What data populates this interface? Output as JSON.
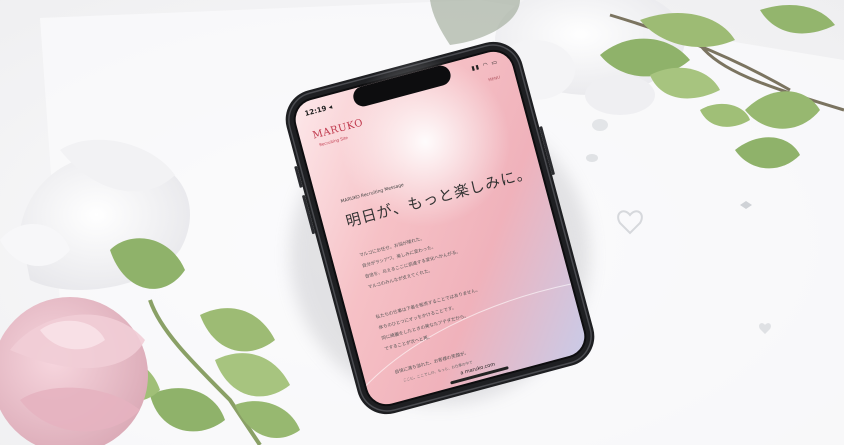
{
  "scene": {
    "description_tags": [
      "smartphone-mockup",
      "flowers",
      "leaves",
      "white-table"
    ],
    "colors": {
      "background": "#f6f6f7",
      "phone_frame": "#1e1f22",
      "screen_gradient_pink": "#f3b7bf",
      "screen_gradient_lavender": "#c8c9e6",
      "brand_red": "#c0394d",
      "leaf_green": "#8fb26a",
      "peony_pink": "#eec0cb"
    }
  },
  "phone": {
    "status_time": "12:19 ◂",
    "status_icons": "▮▮ ◠ ▭",
    "menu_link": "MENU",
    "brand": "MARUKO",
    "brand_subtitle": "Recruiting Site",
    "kicker": "MARUKO Recruiting Message",
    "headline": "明日が、もっと楽しみに。",
    "paragraph1": [
      "マルコにお任せ。お悩が晴れた。",
      "自分がラシアワ。楽しみに変わった。",
      "自信を、与えるここに前進する変化へかんがる。",
      "マルコのみんなが支えてくれた。"
    ],
    "paragraph2": [
      "私たちの仕事は下着を販売することではありません。",
      "体ちのひとつにオッをかけることです。",
      "同に綺麗をしたときの美なたアテダだから。",
      "ですることが次へと再。"
    ],
    "closing": "自信に満ち溢れた、お客様の笑顔が。",
    "footer": "ここに、ここでしか、もっと、お仕事の中で",
    "url": "a maruko.com"
  }
}
